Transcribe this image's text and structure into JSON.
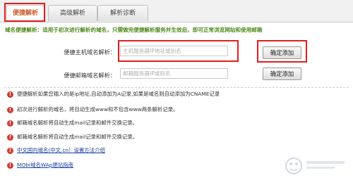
{
  "tabs": [
    {
      "label": "便捷解析",
      "active": true
    },
    {
      "label": "高级解析",
      "active": false
    },
    {
      "label": "解析诊断",
      "active": false
    }
  ],
  "intro": "域名便捷解析：适用于初次进行解析的域名，只需做完便捷解析服务并生效后，即可正常浏览网站和使用邮箱",
  "form": {
    "host": {
      "label": "便捷主机域名解析：",
      "placeholder": "主机服务器IP地址或别名",
      "button": "确定添加"
    },
    "mail": {
      "label": "便捷邮箱域名解析：",
      "placeholder": "邮箱服务器IP或别名",
      "button": "确定添加"
    }
  },
  "notes": [
    "便捷解析如果您输入的是ip地址,自动添加为A记录,如果是域名则自动添加为CNAME记录",
    "初次进行解析的域名，将自动生成www和不包含www两条解析记录。",
    "邮箱域名解析将自动生成mail记录和邮件交换记录。",
    "邮箱域名解析将自动生成mail记录和邮件交换记录。"
  ],
  "links": [
    "中文国内域名(中文.cn）设置方法介绍",
    "MObi域名WAp建站指南"
  ],
  "colors": {
    "highlight": "#e21c1c",
    "active_tab_text": "#d0572a",
    "intro_text": "#4f8a1a",
    "link": "#1a3d9e",
    "note_icon": "#d23a2f"
  },
  "icons": {
    "note": "exclamation-circle-icon"
  }
}
